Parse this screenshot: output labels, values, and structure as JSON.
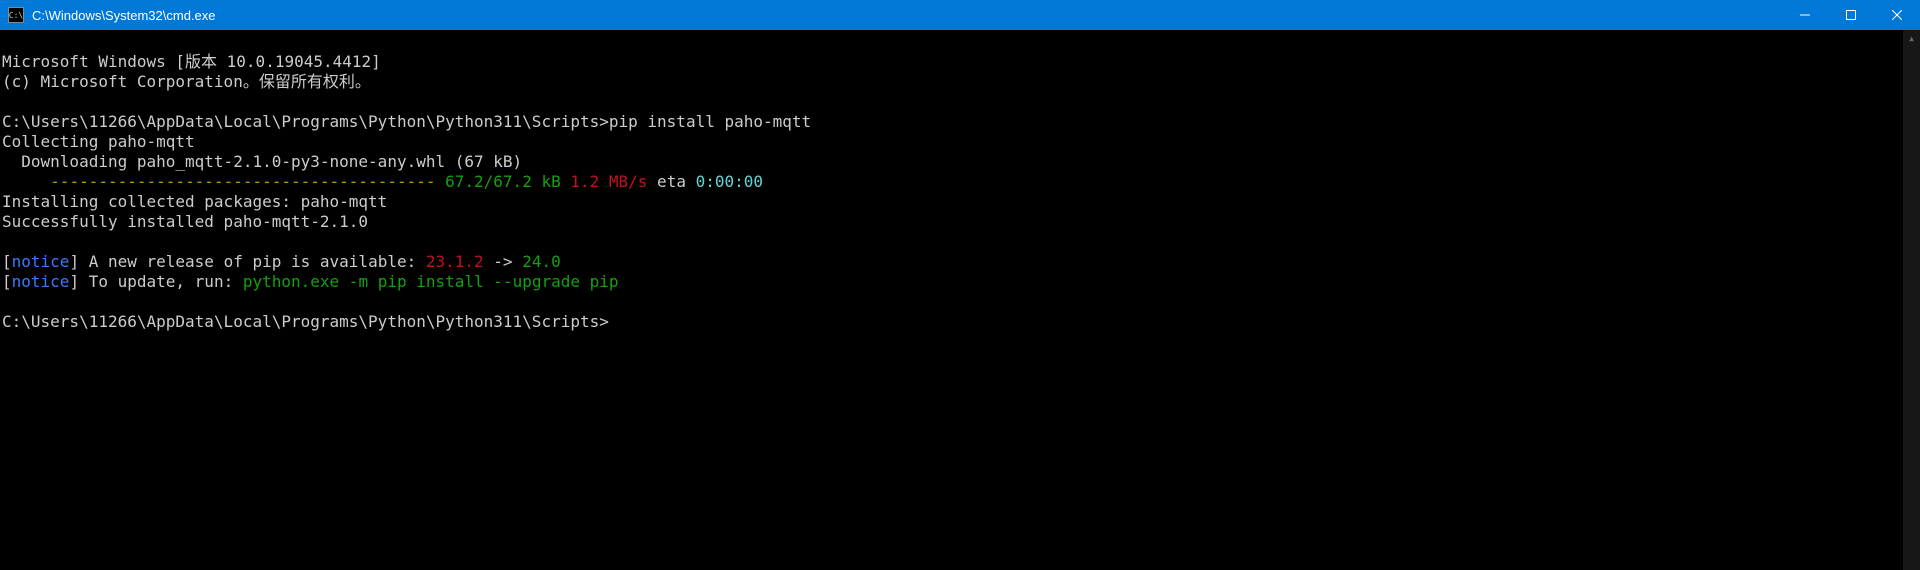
{
  "titlebar": {
    "icon_text": "C:\\",
    "title": "C:\\Windows\\System32\\cmd.exe"
  },
  "lines": {
    "l1": "Microsoft Windows [版本 10.0.19045.4412]",
    "l2": "(c) Microsoft Corporation。保留所有权利。",
    "l3": "",
    "l4_prompt": "C:\\Users\\11266\\AppData\\Local\\Programs\\Python\\Python311\\Scripts>",
    "l4_cmd": "pip install paho-mqtt",
    "l5": "Collecting paho-mqtt",
    "l6": "  Downloading paho_mqtt-2.1.0-py3-none-any.whl (67 kB)",
    "l7_pad": "     ",
    "l7_dashes": "---------------------------------------- ",
    "l7_size": "67.2/67.2 kB",
    "l7_speed": " 1.2 MB/s",
    "l7_eta_lbl": " eta ",
    "l7_eta": "0:00:00",
    "l8": "Installing collected packages: paho-mqtt",
    "l9": "Successfully installed paho-mqtt-2.1.0",
    "l10": "",
    "l11_b1": "[",
    "l11_notice": "notice",
    "l11_b2": "]",
    "l11_text": " A new release of pip is available: ",
    "l11_old": "23.1.2",
    "l11_arrow": " -> ",
    "l11_new": "24.0",
    "l12_b1": "[",
    "l12_notice": "notice",
    "l12_b2": "]",
    "l12_text": " To update, run: ",
    "l12_cmd": "python.exe -m pip install --upgrade pip",
    "l13": "",
    "l14_prompt": "C:\\Users\\11266\\AppData\\Local\\Programs\\Python\\Python311\\Scripts>"
  }
}
